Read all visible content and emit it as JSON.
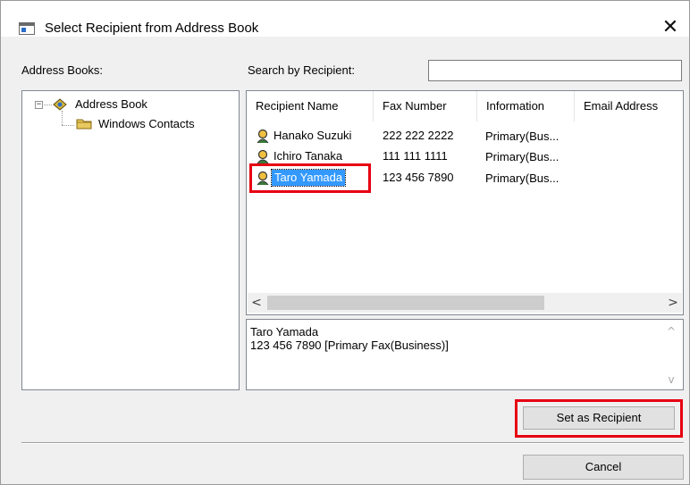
{
  "window": {
    "title": "Select Recipient from Address Book",
    "close_symbol": "✕"
  },
  "address_books": {
    "label": "Address Books:",
    "tree": [
      {
        "label": "Address Book",
        "icon": "address-book-icon",
        "expander": "⊟"
      },
      {
        "label": "Windows Contacts",
        "icon": "folder-icon"
      }
    ]
  },
  "search": {
    "label": "Search by Recipient:",
    "value": "",
    "placeholder": ""
  },
  "recipients": {
    "columns": [
      "Recipient Name",
      "Fax Number",
      "Information",
      "Email Address"
    ],
    "rows": [
      {
        "name": "Hanako Suzuki",
        "fax": "222 222 2222",
        "info": "Primary(Bus..."
      },
      {
        "name": "Ichiro Tanaka",
        "fax": "111 111 1111",
        "info": "Primary(Bus..."
      },
      {
        "name": "Taro Yamada",
        "fax": "123 456 7890",
        "info": "Primary(Bus...",
        "selected": true
      }
    ],
    "scroll_left": "<",
    "scroll_right": ">"
  },
  "details": {
    "line1": "Taro Yamada",
    "line2": "123 456 7890 [Primary Fax(Business)]",
    "scroll_up": "^",
    "scroll_down": "v"
  },
  "buttons": {
    "set_as_recipient": "Set as Recipient",
    "cancel": "Cancel"
  },
  "colors": {
    "selection": "#3399ff",
    "highlight": "#e60012"
  }
}
